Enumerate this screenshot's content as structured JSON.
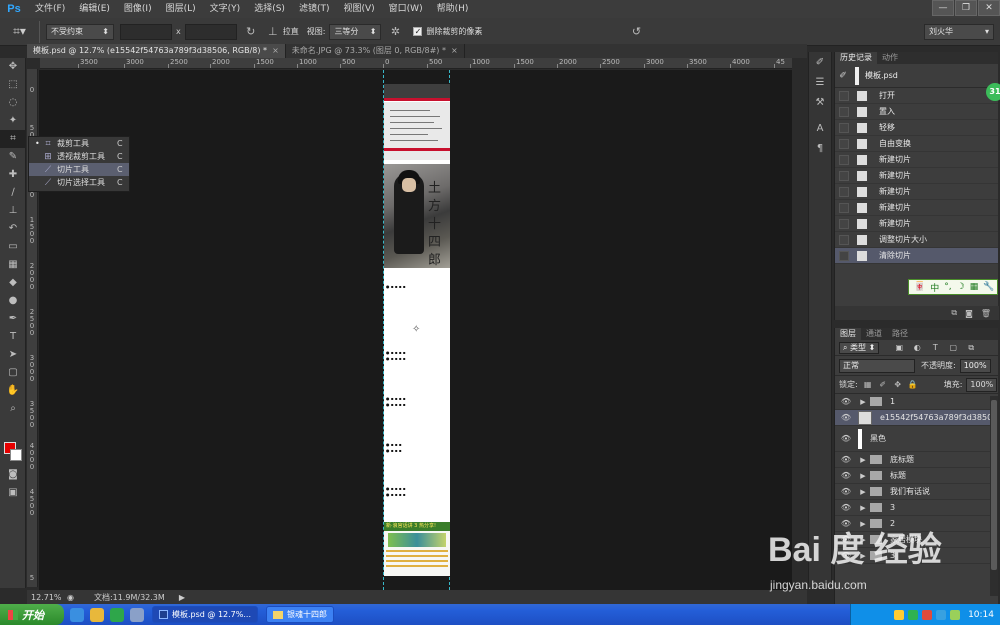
{
  "app": {
    "logo": "Ps"
  },
  "menu": [
    "文件(F)",
    "编辑(E)",
    "图像(I)",
    "图层(L)",
    "文字(Y)",
    "选择(S)",
    "滤镜(T)",
    "视图(V)",
    "窗口(W)",
    "帮助(H)"
  ],
  "options": {
    "constraint": "不受约束",
    "x_sep": "x",
    "straighten": "拉直",
    "view_label": "视图:",
    "view_value": "三等分",
    "delete_cropped": "删除裁剪的像素",
    "user": "刘火华"
  },
  "tabs": [
    {
      "title": "模板.psd @ 12.7% (e15542f54763a789f3d38506, RGB/8) *",
      "close": "×"
    },
    {
      "title": "未命名.JPG @ 73.3% (图层 0, RGB/8#) *",
      "close": "×"
    }
  ],
  "ruler_top": [
    "3500",
    "3000",
    "2500",
    "2000",
    "1500",
    "1000",
    "500",
    "0",
    "500",
    "1000",
    "1500",
    "2000",
    "2500",
    "3000",
    "3500",
    "4000",
    "45"
  ],
  "ruler_left": [
    "0",
    "5\n0\n0",
    "1\n0\n0\n0",
    "1\n5\n0\n0",
    "2\n0\n0\n0",
    "2\n5\n0\n0",
    "3\n0\n0\n0",
    "3\n5\n0\n0",
    "4\n0\n0\n0",
    "4\n5\n0\n0",
    "5"
  ],
  "flyout": [
    {
      "bullet": "•",
      "icon": "crop",
      "label": "裁剪工具",
      "key": "C"
    },
    {
      "bullet": "",
      "icon": "perspective-crop",
      "label": "透视裁剪工具",
      "key": "C"
    },
    {
      "bullet": "",
      "icon": "slice",
      "label": "切片工具",
      "key": "C"
    },
    {
      "bullet": "",
      "icon": "slice-select",
      "label": "切片选择工具",
      "key": "C"
    }
  ],
  "canvas": {
    "calligraphy": "土方十四郎",
    "banner_text": "新·浪官话讲 3 热分享!"
  },
  "status": {
    "zoom": "12.71%",
    "doc": "文档:11.9M/32.3M"
  },
  "history": {
    "tabs": [
      "历史记录",
      "动作"
    ],
    "snapshot": "模板.psd",
    "items": [
      "打开",
      "置入",
      "轻移",
      "自由变换",
      "新建切片",
      "新建切片",
      "新建切片",
      "新建切片",
      "新建切片",
      "调整切片大小",
      "清除切片"
    ]
  },
  "ime": {
    "chars": [
      "中",
      "°,",
      "☽",
      "▦",
      "🔧"
    ]
  },
  "layers": {
    "tabs": [
      "图层",
      "通道",
      "路径"
    ],
    "filter": "类型",
    "blend": "正常",
    "opacity_label": "不透明度:",
    "opacity": "100%",
    "lock_label": "锁定:",
    "fill_label": "填充:",
    "fill": "100%",
    "items": [
      {
        "name": "1",
        "type": "folder"
      },
      {
        "name": "e15542f54763a789f3d38506",
        "type": "smart",
        "selected": true
      },
      {
        "name": "黑色",
        "type": "white"
      },
      {
        "name": "底标题",
        "type": "folder"
      },
      {
        "name": "标题",
        "type": "folder"
      },
      {
        "name": "我们有话说",
        "type": "folder"
      },
      {
        "name": "3",
        "type": "folder"
      },
      {
        "name": "2",
        "type": "folder"
      },
      {
        "name": "家居模块",
        "type": "folder"
      },
      {
        "name": "3",
        "type": "folder"
      }
    ]
  },
  "badge": "31",
  "watermark": {
    "logo": "Bai 度 经验",
    "url": "jingyan.baidu.com"
  },
  "taskbar": {
    "start": "开始",
    "tasks": [
      "模板.psd @ 12.7%...",
      "银魂十四郎"
    ],
    "clock": "10:14"
  }
}
